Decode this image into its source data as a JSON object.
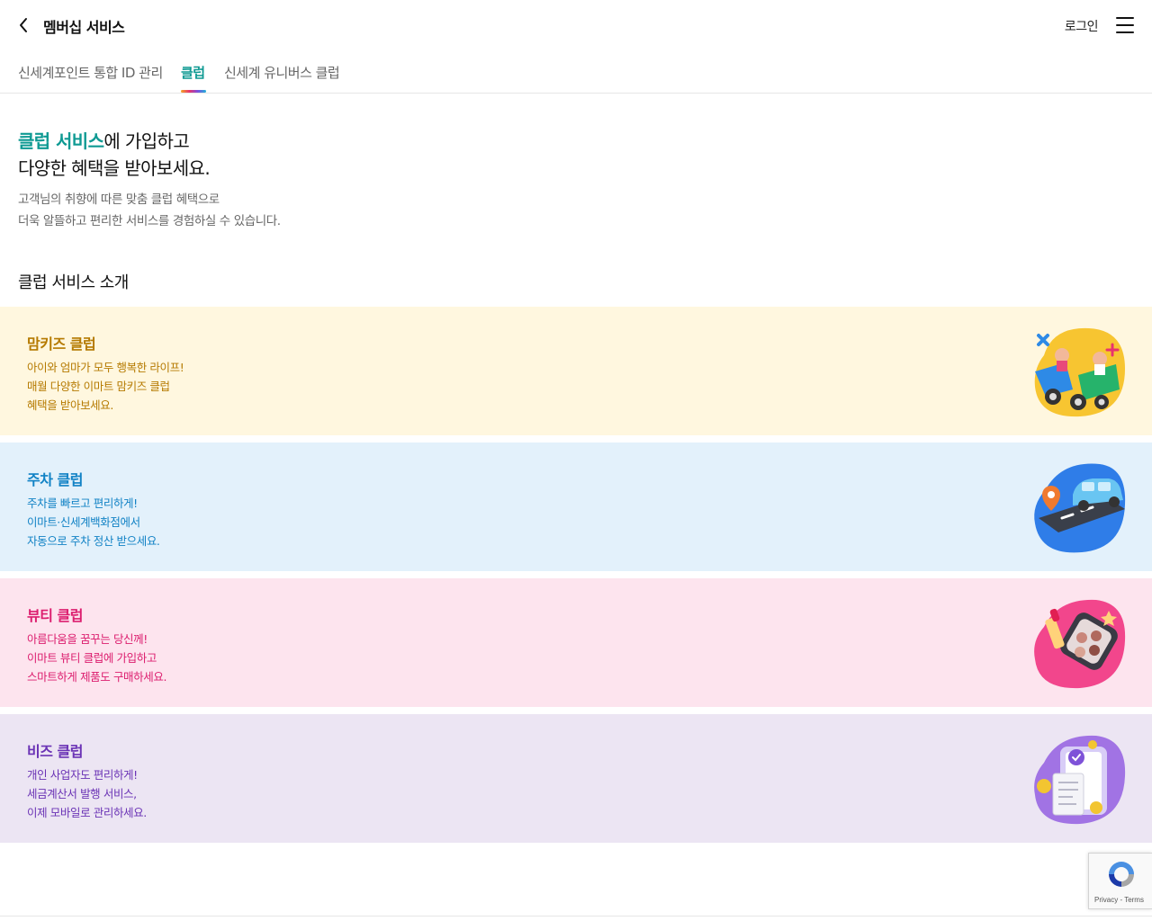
{
  "header": {
    "title": "멤버십 서비스",
    "login_label": "로그인"
  },
  "tabs": [
    {
      "label": "신세계포인트 통합 ID 관리"
    },
    {
      "label": "클럽",
      "active": true
    },
    {
      "label": "신세계 유니버스 클럽"
    }
  ],
  "hero": {
    "accent": "클럽 서비스",
    "line1_rest": "에 가입하고",
    "line2": "다양한 혜택을 받아보세요.",
    "sub1": "고객님의 취향에 따른 맞춤 클럽 혜택으로",
    "sub2": "더욱 알뜰하고 편리한 서비스를 경험하실 수 있습니다."
  },
  "section": {
    "title": "클럽 서비스 소개"
  },
  "clubs": [
    {
      "name": "맘키즈 클럽",
      "lines": [
        "아이와 엄마가 모두 행복한 라이프!",
        "매월 다양한 이마트 맘키즈 클럽",
        "혜택을 받아보세요."
      ],
      "color": "#b57a00",
      "icon": "kids-car-icon"
    },
    {
      "name": "주차 클럽",
      "lines": [
        "주차를 빠르고 편리하게!",
        "이마트·신세계백화점에서",
        "자동으로 주차 정산 받으세요."
      ],
      "color": "#1182c5",
      "icon": "parking-car-icon"
    },
    {
      "name": "뷰티 클럽",
      "lines": [
        "아름다움을 꿈꾸는 당신께!",
        "이마트 뷰티 클럽에 가입하고",
        "스마트하게 제품도 구매하세요."
      ],
      "color": "#dc1d6e",
      "icon": "cosmetics-icon"
    },
    {
      "name": "비즈 클럽",
      "lines": [
        "개인 사업자도 편리하게!",
        "세금계산서 발행 서비스,",
        "이제 모바일로 관리하세요."
      ],
      "color": "#6a32b5",
      "icon": "receipt-phone-icon"
    }
  ],
  "recaptcha": {
    "links": "Privacy - Terms"
  },
  "colors": {
    "accent": "#0f9a93",
    "mom_bg": "#fff7df",
    "parking_bg": "#e3f1fb",
    "beauty_bg": "#fde4ee",
    "biz_bg": "#ece5f3"
  }
}
